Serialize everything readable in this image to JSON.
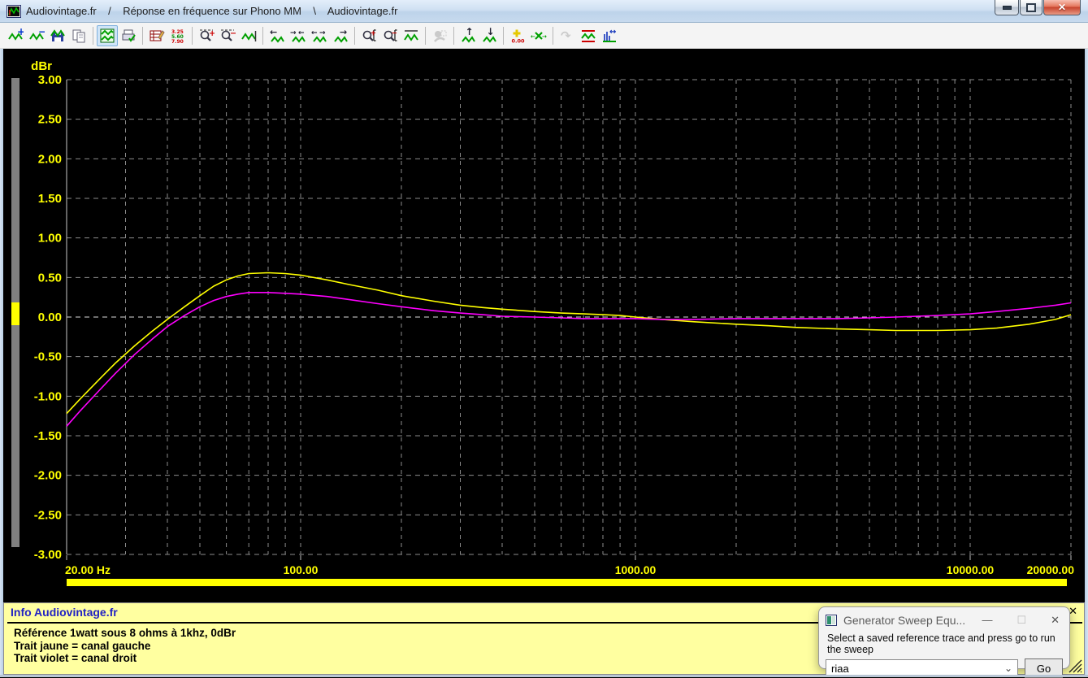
{
  "window": {
    "title": "Audiovintage.fr    /    Réponse en fréquence sur Phono MM    \\    Audiovintage.fr",
    "controls": [
      "minimize",
      "maximize",
      "close"
    ]
  },
  "icons": {
    "close_glyph": "✕",
    "minimize_glyph": "—",
    "maximize_glyph": "❐",
    "chevron_glyph": "⌄",
    "dialog_close_glyph": "✕",
    "dialog_minimize_glyph": "—",
    "dialog_maximize_glyph": "☐"
  },
  "toolbar": {
    "buttons": [
      {
        "name": "add-trace"
      },
      {
        "name": "subtract-trace"
      },
      {
        "name": "save-trace"
      },
      {
        "name": "copy-trace"
      },
      {
        "name": "show-graph",
        "sep": true,
        "active": true
      },
      {
        "name": "print-graph"
      },
      {
        "name": "edit-values",
        "sep": true
      },
      {
        "name": "value-list"
      },
      {
        "name": "zoom-in-x",
        "sep": true
      },
      {
        "name": "zoom-out-x"
      },
      {
        "name": "fit-trace"
      },
      {
        "name": "pan-left",
        "sep": true
      },
      {
        "name": "compress-x"
      },
      {
        "name": "expand-x"
      },
      {
        "name": "pan-right"
      },
      {
        "name": "zoom-in-y",
        "sep": true
      },
      {
        "name": "zoom-out-y"
      },
      {
        "name": "autoscale-y"
      },
      {
        "name": "process-tool",
        "sep": true,
        "disabled": true
      },
      {
        "name": "shift-up",
        "sep": true
      },
      {
        "name": "shift-down"
      },
      {
        "name": "marker-add",
        "sep": true
      },
      {
        "name": "marker-clear"
      },
      {
        "name": "repeat-sweep",
        "sep": true,
        "disabled": true
      },
      {
        "name": "limit-lines"
      },
      {
        "name": "sweep-settings"
      }
    ]
  },
  "colors": {
    "plot_background": "#000000",
    "grid": "#8c8c8c",
    "axis_labels": "#ffff00",
    "left_channel": "#ffff00",
    "right_channel": "#ff00ff",
    "progress_bar": "#ffff00",
    "info_panel_background": "#ffffa0",
    "info_header_text": "#2121c4",
    "meter_bar": "#808080"
  },
  "chart_data": {
    "type": "line",
    "title": "Réponse en fréquence sur Phono MM",
    "ylabel": "dBr",
    "x_scale": "log",
    "xlim": [
      20,
      20000
    ],
    "ylim": [
      -3,
      3
    ],
    "y_step": 0.5,
    "grid": "dashed",
    "x_ticks": [
      {
        "f": 20,
        "label": "20.00 Hz",
        "anchor": "start"
      },
      {
        "f": 100,
        "label": "100.00",
        "anchor": "middle"
      },
      {
        "f": 1000,
        "label": "1000.00",
        "anchor": "middle"
      },
      {
        "f": 10000,
        "label": "10000.00",
        "anchor": "middle"
      },
      {
        "f": 20000,
        "label": "20000.00",
        "anchor": "end"
      }
    ],
    "series": [
      {
        "name": "canal gauche",
        "color": "#ffff00",
        "points": [
          [
            20,
            -1.22
          ],
          [
            22,
            -1.03
          ],
          [
            25,
            -0.79
          ],
          [
            28,
            -0.58
          ],
          [
            32,
            -0.36
          ],
          [
            36,
            -0.18
          ],
          [
            40,
            -0.03
          ],
          [
            45,
            0.13
          ],
          [
            50,
            0.27
          ],
          [
            55,
            0.39
          ],
          [
            60,
            0.47
          ],
          [
            65,
            0.52
          ],
          [
            70,
            0.55
          ],
          [
            80,
            0.56
          ],
          [
            90,
            0.55
          ],
          [
            100,
            0.53
          ],
          [
            120,
            0.47
          ],
          [
            140,
            0.41
          ],
          [
            170,
            0.34
          ],
          [
            200,
            0.27
          ],
          [
            250,
            0.2
          ],
          [
            300,
            0.15
          ],
          [
            350,
            0.12
          ],
          [
            400,
            0.1
          ],
          [
            500,
            0.07
          ],
          [
            600,
            0.05
          ],
          [
            700,
            0.04
          ],
          [
            800,
            0.03
          ],
          [
            900,
            0.02
          ],
          [
            1000,
            0.0
          ],
          [
            1200,
            -0.03
          ],
          [
            1500,
            -0.06
          ],
          [
            2000,
            -0.09
          ],
          [
            2500,
            -0.11
          ],
          [
            3000,
            -0.13
          ],
          [
            4000,
            -0.15
          ],
          [
            5000,
            -0.16
          ],
          [
            6000,
            -0.17
          ],
          [
            8000,
            -0.17
          ],
          [
            10000,
            -0.16
          ],
          [
            12000,
            -0.14
          ],
          [
            15000,
            -0.09
          ],
          [
            18000,
            -0.03
          ],
          [
            20000,
            0.03
          ]
        ]
      },
      {
        "name": "canal droit",
        "color": "#ff00ff",
        "points": [
          [
            20,
            -1.38
          ],
          [
            22,
            -1.18
          ],
          [
            25,
            -0.93
          ],
          [
            28,
            -0.71
          ],
          [
            32,
            -0.47
          ],
          [
            36,
            -0.28
          ],
          [
            40,
            -0.12
          ],
          [
            45,
            0.02
          ],
          [
            50,
            0.13
          ],
          [
            55,
            0.21
          ],
          [
            60,
            0.26
          ],
          [
            65,
            0.29
          ],
          [
            70,
            0.31
          ],
          [
            80,
            0.31
          ],
          [
            90,
            0.3
          ],
          [
            100,
            0.29
          ],
          [
            120,
            0.26
          ],
          [
            140,
            0.22
          ],
          [
            170,
            0.17
          ],
          [
            200,
            0.13
          ],
          [
            250,
            0.08
          ],
          [
            300,
            0.05
          ],
          [
            350,
            0.03
          ],
          [
            400,
            0.01
          ],
          [
            500,
            0.0
          ],
          [
            600,
            -0.01
          ],
          [
            700,
            -0.02
          ],
          [
            800,
            -0.02
          ],
          [
            1000,
            -0.02
          ],
          [
            1200,
            -0.03
          ],
          [
            1500,
            -0.03
          ],
          [
            2000,
            -0.02
          ],
          [
            2500,
            -0.02
          ],
          [
            3000,
            -0.02
          ],
          [
            4000,
            -0.02
          ],
          [
            5000,
            -0.01
          ],
          [
            6000,
            0.0
          ],
          [
            8000,
            0.02
          ],
          [
            10000,
            0.04
          ],
          [
            12000,
            0.07
          ],
          [
            15000,
            0.11
          ],
          [
            18000,
            0.15
          ],
          [
            20000,
            0.18
          ]
        ]
      }
    ]
  },
  "progress": {
    "status": "complete"
  },
  "info": {
    "title": "Info Audiovintage.fr",
    "lines": [
      "Référence 1watt sous 8 ohms à 1khz, 0dBr",
      "Trait jaune = canal gauche",
      "Trait violet = canal droit"
    ]
  },
  "dialog": {
    "title": "Generator Sweep Equ...",
    "instruction": "Select a saved reference trace and press go to run the sweep",
    "combo_value": "riaa",
    "go_label": "Go"
  }
}
